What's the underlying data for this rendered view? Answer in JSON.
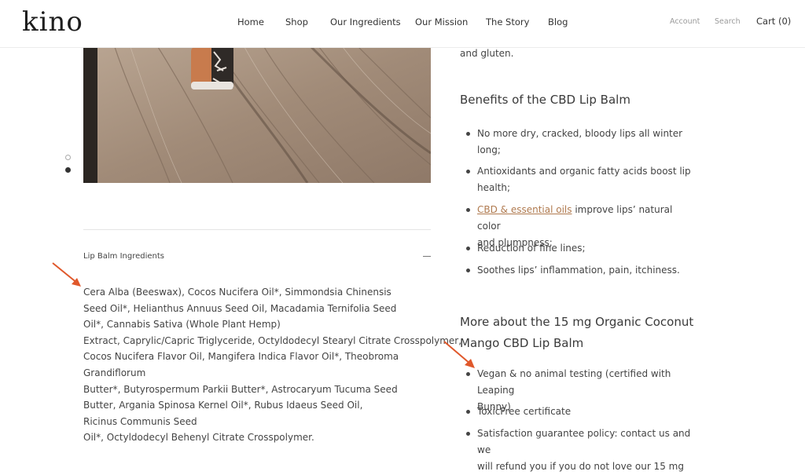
{
  "header": {
    "logo": "kino",
    "nav": [
      "Home",
      "Shop",
      "Our Ingredients",
      "Our Mission",
      "The Story",
      "Blog"
    ],
    "account": "Account",
    "search": "Search",
    "cart": "Cart (0)"
  },
  "gallery": {
    "slide_count": 2,
    "active_slide": 2
  },
  "accordion": {
    "title": "Lip Balm Ingredients",
    "lines": [
      "Cera Alba (Beeswax), Cocos Nucifera Oil*, Simmondsia Chinensis",
      "Seed Oil*, Helianthus Annuus Seed Oil, Macadamia Ternifolia Seed",
      "Oil*, Cannabis Sativa (Whole Plant Hemp)",
      "Extract,  Caprylic/Capric Triglyceride, Octyldodecyl Stearyl Citrate Crosspolymer,",
      "Cocos Nucifera Flavor Oil, Mangifera Indica  Flavor Oil*, Theobroma",
      "Grandiflorum",
      "Butter*, Butyrospermum Parkii Butter*, Astrocaryum Tucuma Seed",
      "Butter, Argania Spinosa Kernel Oil*, Rubus Idaeus Seed Oil,",
      "Ricinus Communis Seed",
      "Oil*, Octyldodecyl Behenyl Citrate Crosspolymer."
    ]
  },
  "right": {
    "top_fragment": "and gluten.",
    "benefits_heading": "Benefits of the CBD Lip Balm",
    "benefits": [
      {
        "lines": [
          "No more dry, cracked, bloody lips all winter",
          "long;"
        ]
      },
      {
        "lines": [
          "Antioxidants and organic fatty acids boost lip",
          "health;"
        ]
      },
      {
        "link": "CBD & essential oils",
        "rest": " improve lips’ natural color",
        "line2": "and plumpness;"
      },
      {
        "lines": [
          "Reduction of fine lines;"
        ]
      },
      {
        "lines": [
          "Soothes lips’ inflammation, pain, itchiness."
        ]
      }
    ],
    "more_heading_line1": "More about the 15 mg Organic Coconut",
    "more_heading_line2": "Mango CBD Lip Balm",
    "more": [
      {
        "lines": [
          "Vegan & no animal testing (certified with Leaping",
          "Bunny)"
        ]
      },
      {
        "lines": [
          "ToxicFree certificate"
        ]
      },
      {
        "lines": [
          "Satisfaction guarantee policy: contact us and we",
          "will refund you if you do not love our 15 mg"
        ]
      }
    ]
  },
  "colors": {
    "arrow": "#e0582b",
    "link": "#b07a4f",
    "text": "#444444"
  }
}
